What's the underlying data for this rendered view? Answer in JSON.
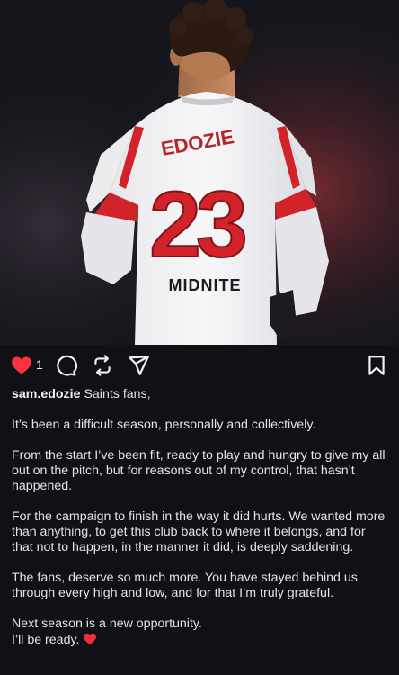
{
  "post": {
    "username": "sam.edozie",
    "caption_opening": "Saints fans,",
    "paragraphs": [
      "It’s been a difficult season, personally and collectively.",
      "From the start I’ve been fit, ready to play and hungry to give my all out on the pitch, but for reasons out of my control, that hasn’t happened.",
      "For the campaign to finish in the way it did hurts. We wanted more than anything, to get this club back to where it belongs, and for that not to happen, in the manner it did, is deeply saddening.",
      "The fans, deserve so much more. You have stayed behind us through every high and low, and for that I’m truly grateful."
    ],
    "closing_line_1": "Next season is a new opportunity.",
    "closing_line_2": "I’ll be ready.",
    "closing_emoji": "red-heart-emoji"
  },
  "photo": {
    "shirt_name": "EDOZIE",
    "shirt_number": "23",
    "sponsor": "MIDNITE"
  },
  "actions": {
    "like_count": "1",
    "liked": true,
    "icons": [
      "heart-icon",
      "comment-icon",
      "repost-icon",
      "share-icon",
      "bookmark-icon"
    ]
  },
  "colors": {
    "background": "#0f1115",
    "like_red": "#ff3040",
    "shirt_red": "#d2232a",
    "text": "#e3e4e8"
  }
}
